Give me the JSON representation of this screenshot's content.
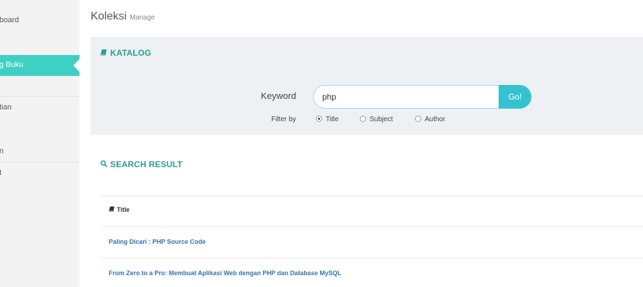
{
  "sidebar": {
    "items": [
      {
        "label": "board"
      },
      {
        "label": "g Buku"
      },
      {
        "label": "tian"
      },
      {
        "label": "n"
      },
      {
        "label": "t"
      }
    ]
  },
  "header": {
    "title": "Koleksi",
    "subtitle": "Manage"
  },
  "katalog": {
    "heading": "KATALOG",
    "keyword_label": "Keyword",
    "search_value": "php",
    "go_label": "Go!",
    "filter_label": "Filter by",
    "filters": [
      {
        "label": "Title",
        "checked": true
      },
      {
        "label": "Subject",
        "checked": false
      },
      {
        "label": "Author",
        "checked": false
      }
    ]
  },
  "results": {
    "heading": "SEARCH RESULT",
    "column_title": "Title",
    "rows": [
      "Paling Dicari : PHP Source Code",
      "From Zero to a Pro: Membuat Aplikasi Web dengan PHP dan Database MySQL"
    ]
  },
  "colors": {
    "accent": "#3fd0c4",
    "heading": "#2a9d95",
    "button": "#35c2d0",
    "link": "#3572b0"
  },
  "icons": {
    "katalog": "book-icon",
    "search_result": "magnifier-icon",
    "title_column": "book-icon"
  }
}
